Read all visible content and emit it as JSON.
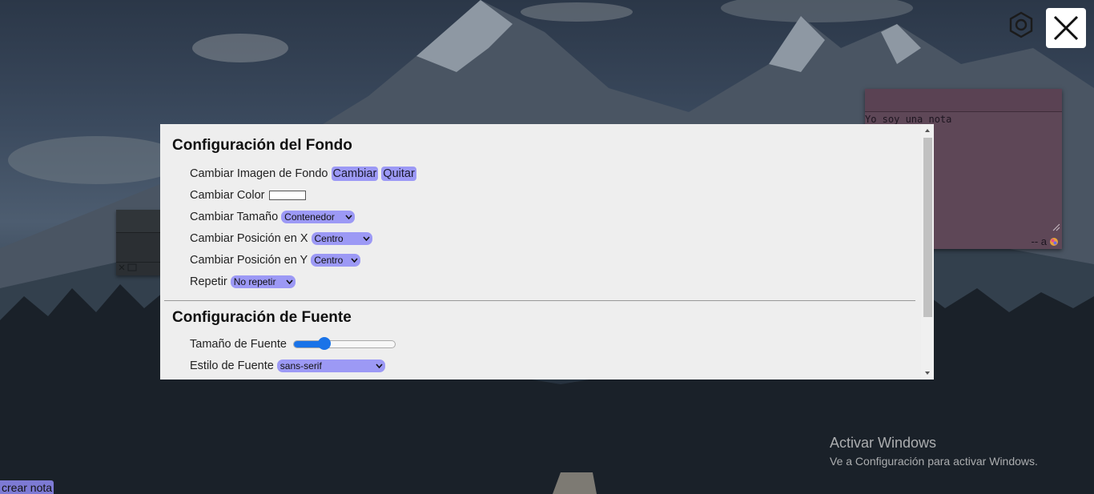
{
  "toolbar": {
    "settings_icon": "gear-icon",
    "close_icon": "close-icon"
  },
  "note": {
    "text": "Yo soy una nota",
    "footer": "-- a",
    "background_color": "#5e4757"
  },
  "settings": {
    "background": {
      "title": "Configuración del Fondo",
      "image_label": "Cambiar Imagen de Fondo",
      "change_button": "Cambiar",
      "remove_button": "Quitar",
      "color_label": "Cambiar Color",
      "color_value": "#ffffff",
      "size_label": "Cambiar Tamaño",
      "size_value": "Contenedor",
      "pos_x_label": "Cambiar Posición en X",
      "pos_x_value": "Centro",
      "pos_y_label": "Cambiar Posición en Y",
      "pos_y_value": "Centro",
      "repeat_label": "Repetir",
      "repeat_value": "No repetir"
    },
    "font": {
      "title": "Configuración de Fuente",
      "size_label": "Tamaño de Fuente",
      "size_slider_fraction": 0.3,
      "style_label": "Estilo de Fuente",
      "style_value": "sans-serif"
    }
  },
  "watermark": {
    "title": "Activar Windows",
    "subtitle": "Ve a Configuración para activar Windows."
  },
  "create_note": {
    "label": "crear nota"
  },
  "colors": {
    "accent": "#9c99f5",
    "panel_bg": "#eeeeee",
    "slider": "#1a73e8"
  }
}
